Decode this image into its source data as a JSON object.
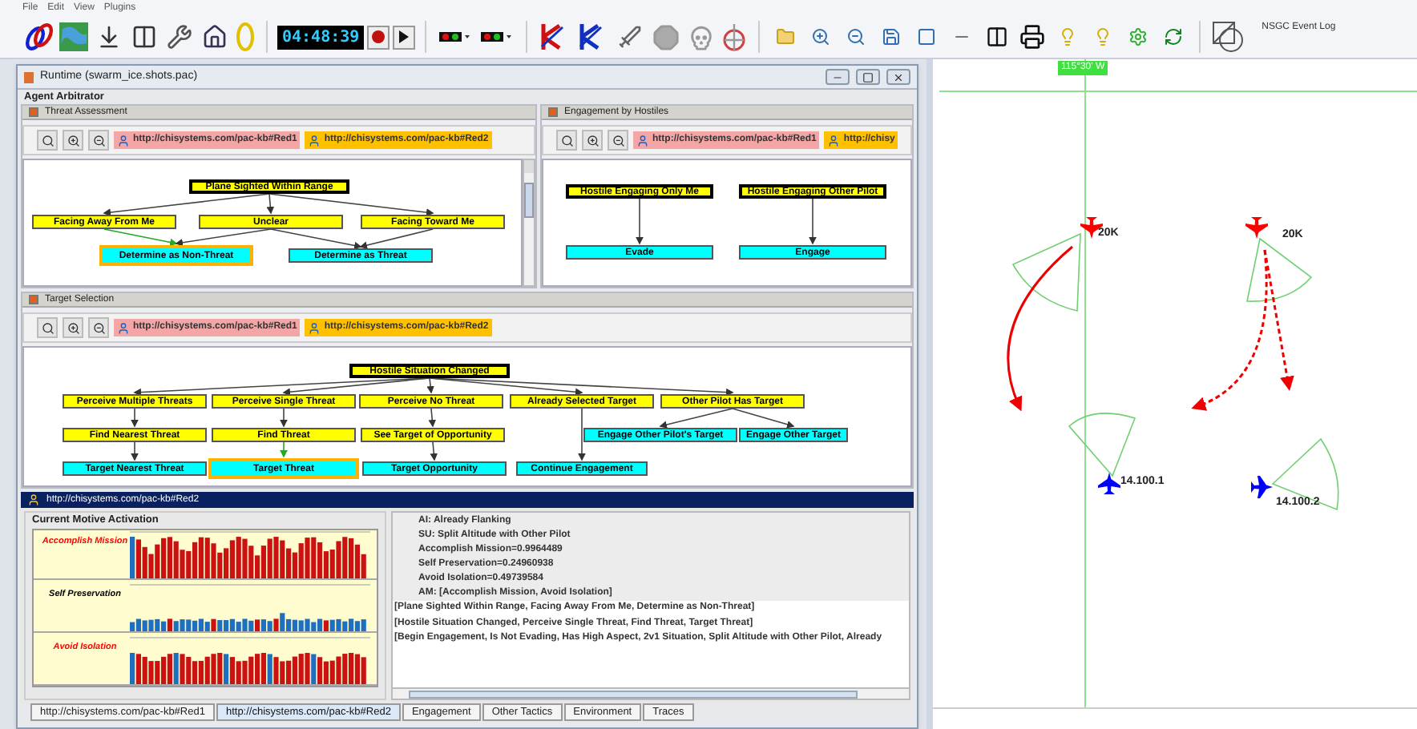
{
  "menu": [
    "File",
    "Edit",
    "View",
    "Plugins"
  ],
  "toolbar": {
    "clock": "04:48:39",
    "event_log": "NSGC Event Log"
  },
  "window": {
    "title": "Runtime (swarm_ice.shots.pac)",
    "section": "Agent Arbitrator"
  },
  "panels": [
    {
      "title": "Threat Assessment",
      "agents": [
        {
          "label": "http://chisystems.com/pac-kb#Red1",
          "color": "#f4a6a6"
        },
        {
          "label": "http://chisystems.com/pac-kb#Red2",
          "color": "#ffc000"
        }
      ],
      "nodes": [
        {
          "label": "Plane Sighted Within Range",
          "kind": "trigger",
          "highlighted": false
        },
        {
          "label": "Facing Away From Me",
          "kind": "condition",
          "highlighted": false
        },
        {
          "label": "Unclear",
          "kind": "condition",
          "highlighted": false
        },
        {
          "label": "Facing Toward Me",
          "kind": "condition",
          "highlighted": false
        },
        {
          "label": "Determine as Non-Threat",
          "kind": "action",
          "highlighted": true
        },
        {
          "label": "Determine as Threat",
          "kind": "action",
          "highlighted": false
        }
      ]
    },
    {
      "title": "Engagement by Hostiles",
      "agents": [
        {
          "label": "http://chisystems.com/pac-kb#Red1",
          "color": "#f4a6a6"
        },
        {
          "label": "http://chisy",
          "color": "#ffc000"
        }
      ],
      "nodes": [
        {
          "label": "Hostile Engaging Only Me",
          "kind": "trigger",
          "highlighted": false
        },
        {
          "label": "Hostile Engaging Other Pilot",
          "kind": "trigger",
          "highlighted": false
        },
        {
          "label": "Evade",
          "kind": "action",
          "highlighted": false
        },
        {
          "label": "Engage",
          "kind": "action",
          "highlighted": false
        }
      ]
    },
    {
      "title": "Target Selection",
      "agents": [
        {
          "label": "http://chisystems.com/pac-kb#Red1",
          "color": "#f4a6a6"
        },
        {
          "label": "http://chisystems.com/pac-kb#Red2",
          "color": "#ffc000"
        }
      ],
      "nodes": [
        {
          "label": "Hostile Situation Changed",
          "kind": "trigger",
          "highlighted": false
        },
        {
          "label": "Perceive Multiple Threats",
          "kind": "condition",
          "highlighted": false
        },
        {
          "label": "Perceive Single Threat",
          "kind": "condition",
          "highlighted": false
        },
        {
          "label": "Perceive No Threat",
          "kind": "condition",
          "highlighted": false
        },
        {
          "label": "Already Selected Target",
          "kind": "condition",
          "highlighted": false
        },
        {
          "label": "Other Pilot Has Target",
          "kind": "condition",
          "highlighted": false
        },
        {
          "label": "Find Nearest Threat",
          "kind": "condition",
          "highlighted": false
        },
        {
          "label": "Find Threat",
          "kind": "condition",
          "highlighted": false
        },
        {
          "label": "See Target of Opportunity",
          "kind": "condition",
          "highlighted": false
        },
        {
          "label": "Engage Other Pilot's Target",
          "kind": "action",
          "highlighted": false
        },
        {
          "label": "Engage Other Target",
          "kind": "action",
          "highlighted": false
        },
        {
          "label": "Target Nearest Threat",
          "kind": "action",
          "highlighted": false
        },
        {
          "label": "Target Threat",
          "kind": "action",
          "highlighted": true
        },
        {
          "label": "Target Opportunity",
          "kind": "action",
          "highlighted": false
        },
        {
          "label": "Continue Engagement",
          "kind": "action",
          "highlighted": false
        }
      ]
    }
  ],
  "agent_view": {
    "title": "http://chisystems.com/pac-kb#Red2",
    "motives_title": "Current Motive Activation",
    "motives": [
      {
        "label": "Accomplish Mission",
        "color": "#ff0000"
      },
      {
        "label": "Self Preservation",
        "color": "#000000"
      },
      {
        "label": "Avoid Isolation",
        "color": "#ff0000"
      }
    ],
    "status": [
      "AI: Already Flanking",
      "SU: Split Altitude with Other Pilot",
      "Accomplish Mission=0.9964489",
      "Self Preservation=0.24960938",
      "Avoid Isolation=0.49739584",
      "AM: [Accomplish Mission, Avoid Isolation]"
    ],
    "log": [
      "[Plane Sighted Within Range, Facing Away From Me, Determine as Non-Threat]",
      "[Hostile Situation Changed, Perceive Single Threat, Find Threat, Target Threat]",
      "[Begin Engagement, Is Not Evading, Has High Aspect, 2v1 Situation, Split Altitude with Other Pilot, Already"
    ]
  },
  "tabs": [
    {
      "label": "http://chisystems.com/pac-kb#Red1",
      "selected": false
    },
    {
      "label": "http://chisystems.com/pac-kb#Red2",
      "selected": true
    },
    {
      "label": "Engagement",
      "selected": false
    },
    {
      "label": "Other Tactics",
      "selected": false
    },
    {
      "label": "Environment",
      "selected": false
    },
    {
      "label": "Traces",
      "selected": false
    }
  ],
  "map": {
    "meridian": "115°30' W",
    "aircraft": [
      {
        "label": "20K",
        "color": "#ff0000"
      },
      {
        "label": "20K",
        "color": "#ff0000"
      },
      {
        "label": "14.100.1",
        "color": "#0000ff"
      },
      {
        "label": "14.100.2",
        "color": "#0000ff"
      }
    ]
  }
}
